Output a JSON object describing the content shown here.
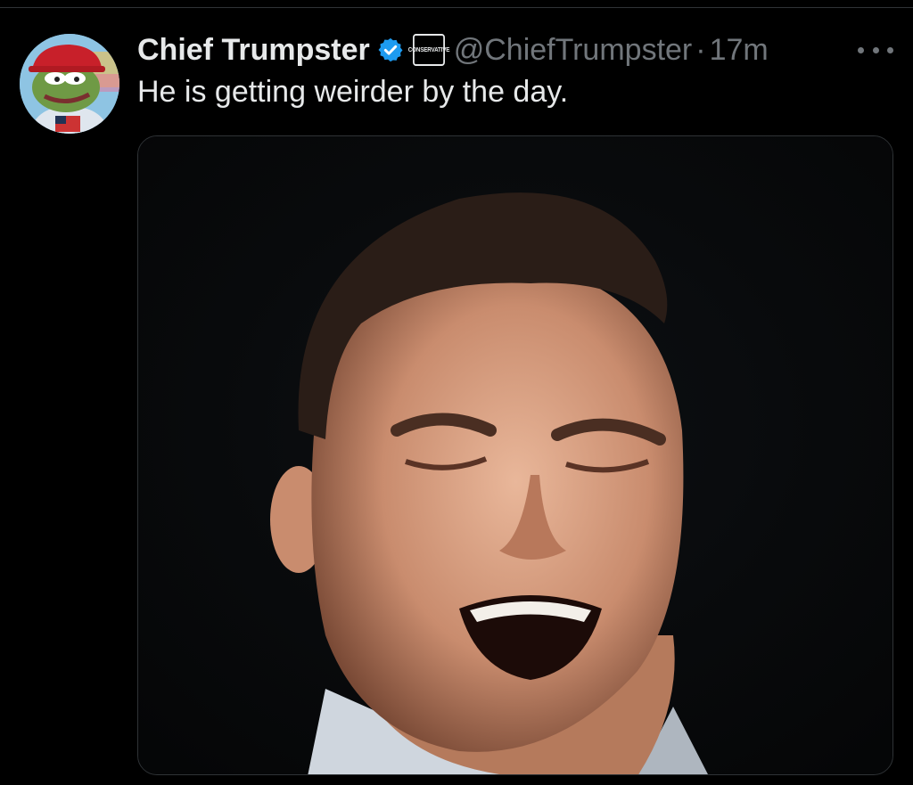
{
  "tweet": {
    "author": {
      "display_name": "Chief Trumpster",
      "handle": "@ChiefTrumpster",
      "verified": true,
      "affiliate_badge_text": "CONSERVATIVE"
    },
    "separator": "·",
    "timestamp": "17m",
    "text": "He is getting weirder by the day.",
    "media": {
      "type": "image",
      "description_icon": "photo-icon"
    }
  },
  "icons": {
    "verified": "verified-badge-icon",
    "more": "more-options-icon"
  },
  "colors": {
    "background": "#000000",
    "primary_text": "#e7e9ea",
    "secondary_text": "#71767b",
    "verified_blue": "#1d9bf0",
    "border": "#2f3336"
  }
}
